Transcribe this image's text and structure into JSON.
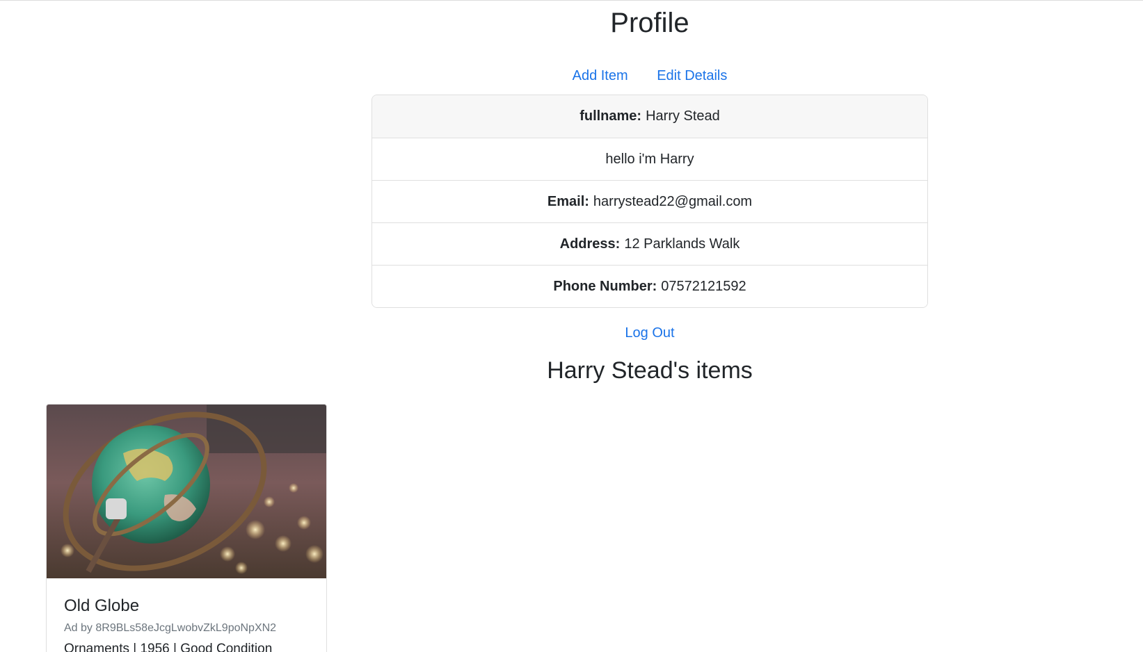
{
  "page": {
    "title": "Profile"
  },
  "actions": {
    "add_item": "Add Item",
    "edit_details": "Edit Details",
    "log_out": "Log Out"
  },
  "profile": {
    "fullname_label": "fullname:",
    "fullname": "Harry Stead",
    "bio": "hello i'm Harry",
    "email_label": "Email:",
    "email": "harrystead22@gmail.com",
    "address_label": "Address:",
    "address": "12 Parklands Walk",
    "phone_label": "Phone Number:",
    "phone": "07572121592"
  },
  "items_section": {
    "heading": "Harry Stead's items",
    "items": [
      {
        "title": "Old Globe",
        "ad_by": "Ad by 8R9BLs58eJcgLwobvZkL9poNpXN2",
        "description": "Ornaments | 1956 | Good Condition"
      }
    ]
  },
  "colors": {
    "link": "#1a73e8",
    "text": "#212529",
    "muted": "#6c757d",
    "card_header_bg": "#f7f7f7",
    "border": "#dfdfdf"
  }
}
